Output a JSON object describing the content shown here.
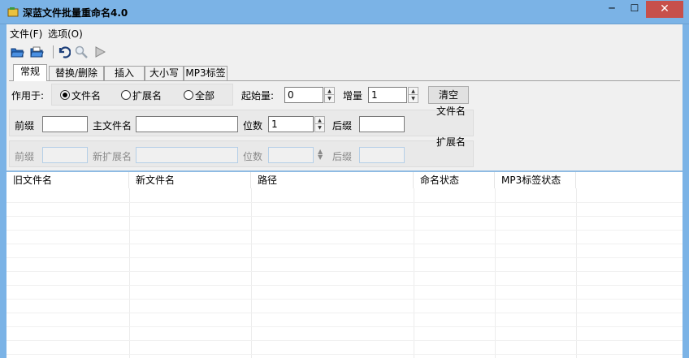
{
  "window": {
    "title": "深蓝文件批量重命名4.0",
    "min_glyph": "─",
    "max_glyph": "☐",
    "close_glyph": "✕"
  },
  "menu": {
    "items": [
      {
        "label": "文件(F)"
      },
      {
        "label": "选项(O)"
      }
    ]
  },
  "toolbar": {
    "icons": [
      "open-folder-icon",
      "save-folder-icon",
      "undo-icon",
      "search-icon",
      "play-icon"
    ]
  },
  "tabs": [
    {
      "label": "常规"
    },
    {
      "label": "替换/删除"
    },
    {
      "label": "插入"
    },
    {
      "label": "大小写"
    },
    {
      "label": "MP3标签"
    }
  ],
  "general": {
    "apply_to_label": "作用于:",
    "radio_filename": "文件名",
    "radio_extension": "扩展名",
    "radio_all": "全部",
    "start_label": "起始量:",
    "start_value": "0",
    "step_label": "增量",
    "step_value": "1",
    "clear_button": "清空",
    "filename_group": {
      "title": "文件名",
      "prefix_label": "前缀",
      "prefix_value": "",
      "main_label": "主文件名",
      "main_value": "",
      "digits_label": "位数",
      "digits_value": "1",
      "suffix_label": "后缀",
      "suffix_value": ""
    },
    "extension_group": {
      "title": "扩展名",
      "prefix_label": "前缀",
      "new_ext_label": "新扩展名",
      "digits_label": "位数",
      "suffix_label": "后缀"
    }
  },
  "list": {
    "columns": [
      "旧文件名",
      "新文件名",
      "路径",
      "命名状态",
      "MP3标签状态"
    ]
  }
}
